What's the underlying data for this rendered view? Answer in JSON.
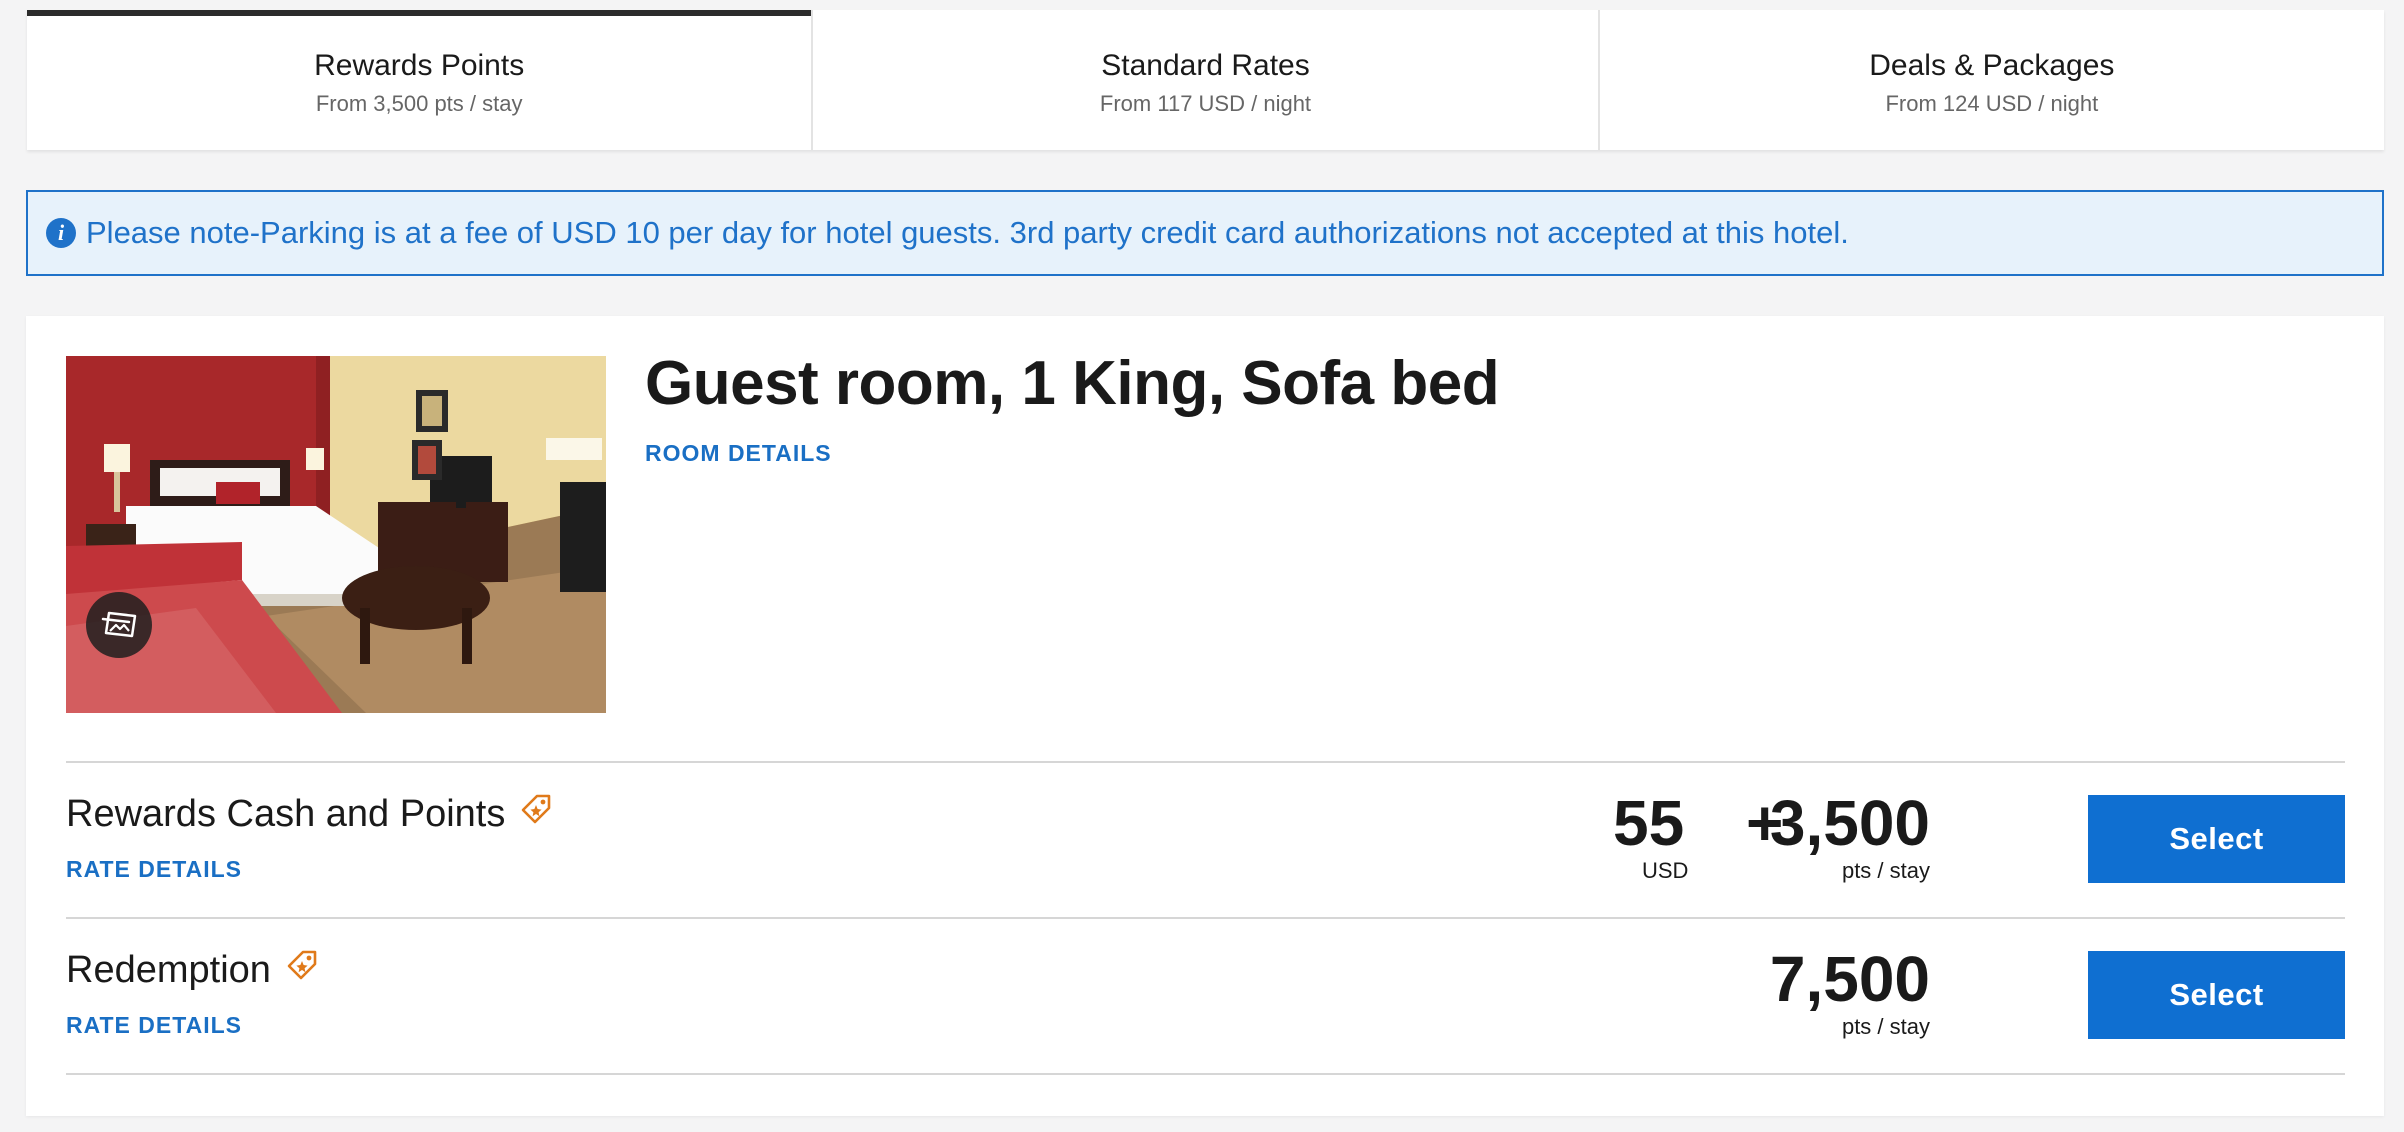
{
  "tabs": [
    {
      "title": "Rewards Points",
      "subtitle": "From 3,500 pts / stay",
      "active": true
    },
    {
      "title": "Standard Rates",
      "subtitle": "From 117 USD / night",
      "active": false
    },
    {
      "title": "Deals & Packages",
      "subtitle": "From 124 USD / night",
      "active": false
    }
  ],
  "notice": {
    "icon": "info-icon",
    "icon_glyph": "i",
    "text": "Please note-Parking is at a fee of USD 10 per day for hotel guests. 3rd party credit card authorizations not accepted at this hotel."
  },
  "room": {
    "title": "Guest room, 1 King, Sofa bed",
    "details_link": "ROOM DETAILS",
    "photo_icon": "gallery-icon"
  },
  "rates": [
    {
      "name": "Rewards Cash and Points",
      "icon": "tag-icon",
      "details_link": "RATE DETAILS",
      "cash_amount": "55",
      "plus": "+",
      "points_amount": "3,500",
      "cash_unit": "USD",
      "points_unit": "pts / stay",
      "button": "Select"
    },
    {
      "name": "Redemption",
      "icon": "tag-icon",
      "details_link": "RATE DETAILS",
      "points_amount": "7,500",
      "points_unit": "pts / stay",
      "button": "Select"
    }
  ],
  "colors": {
    "accent": "#1f72c9",
    "button": "#0f6fd1",
    "notice_bg": "#e7f2fb",
    "tag_icon": "#e07a1a"
  }
}
